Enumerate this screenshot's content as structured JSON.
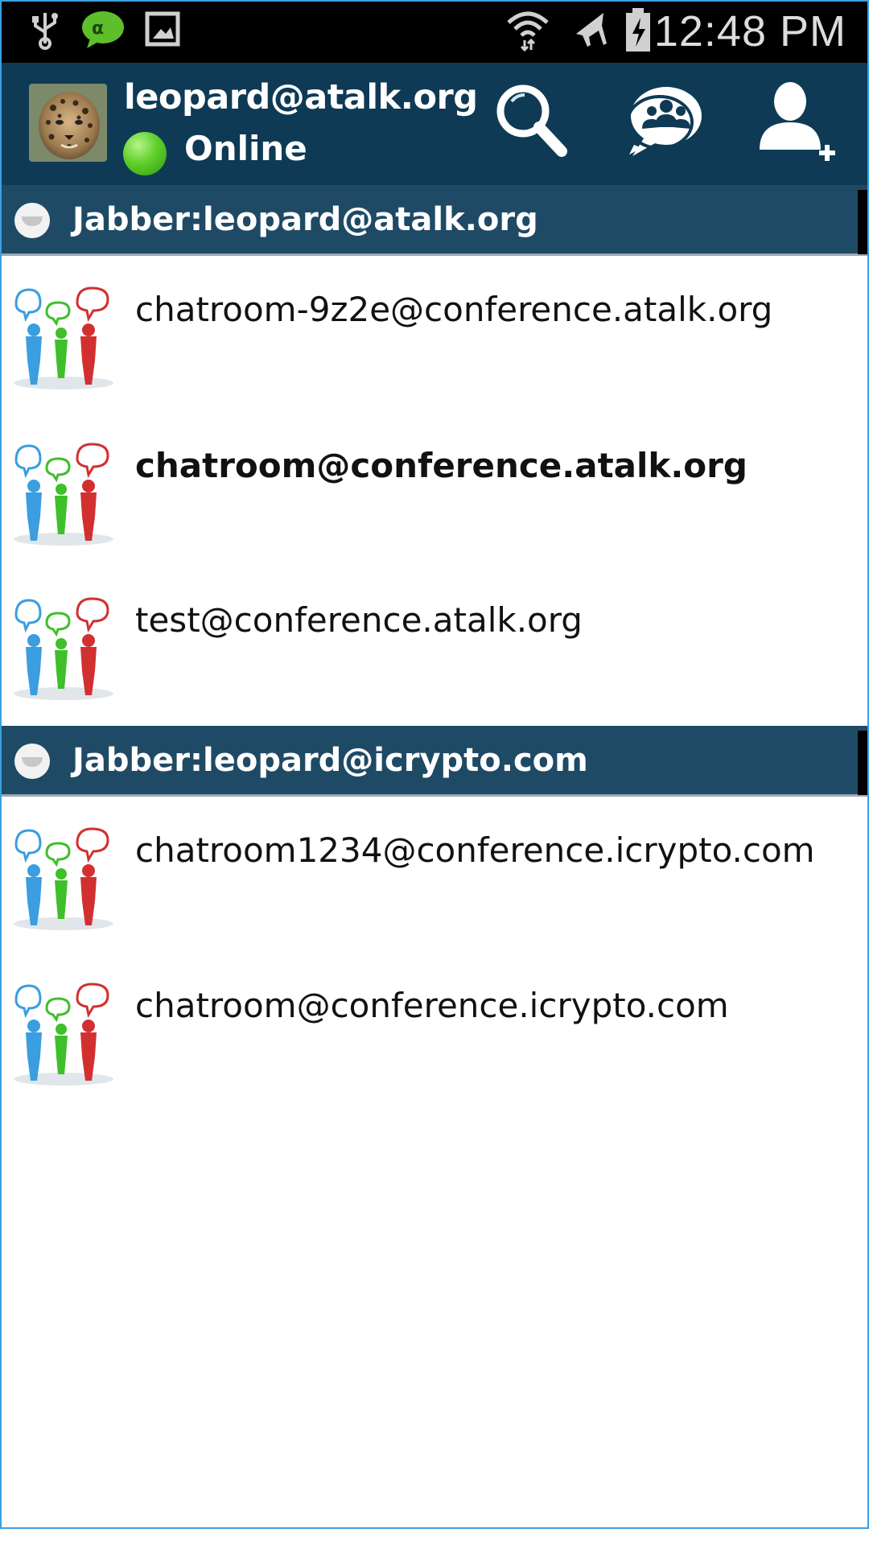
{
  "status_bar": {
    "time": "12:48 PM",
    "left_icons": [
      "usb-icon",
      "atalk-app-icon",
      "gallery-icon"
    ],
    "right_icons": [
      "wifi-icon",
      "airplane-mode-icon",
      "battery-charging-icon"
    ]
  },
  "action_bar": {
    "account": "leopard@atalk.org",
    "presence": "Online",
    "presence_color": "#4cc21f",
    "background_color": "#0e3a55",
    "actions": [
      "search-icon",
      "chat-rooms-icon",
      "add-contact-icon"
    ]
  },
  "groups": [
    {
      "title": "Jabber:leopard@atalk.org",
      "rooms": [
        {
          "name": "chatroom-9z2e@conference.atalk.org",
          "bold": false
        },
        {
          "name": "chatroom@conference.atalk.org",
          "bold": true
        },
        {
          "name": "test@conference.atalk.org",
          "bold": false
        }
      ]
    },
    {
      "title": "Jabber:leopard@icrypto.com",
      "rooms": [
        {
          "name": "chatroom1234@conference.icrypto.com",
          "bold": false
        },
        {
          "name": "chatroom@conference.icrypto.com",
          "bold": false
        }
      ]
    }
  ],
  "colors": {
    "group_header": "#1f4a66",
    "frame": "#3aa0e0"
  }
}
